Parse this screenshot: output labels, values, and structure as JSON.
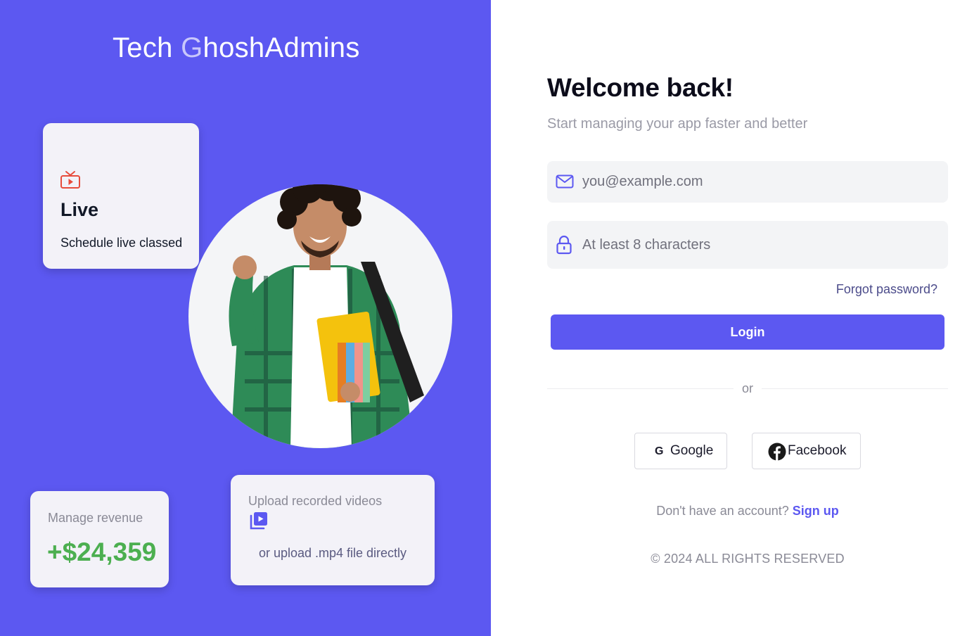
{
  "brand": {
    "part1": "Tech ",
    "part2": "G",
    "part3": "hoshAdmins"
  },
  "cards": {
    "live": {
      "icon": "live-tv-icon",
      "title": "Live",
      "subtitle": "Schedule live classed"
    },
    "revenue": {
      "label": "Manage revenue",
      "value": "+$24,359"
    },
    "upload": {
      "label": "Upload recorded videos",
      "icon": "video-library-icon",
      "subtitle": "or upload .mp4 file directly"
    }
  },
  "login": {
    "heading": "Welcome back!",
    "subheading": "Start managing your app faster and better",
    "email": {
      "icon": "mail-icon",
      "value": "",
      "placeholder": "you@example.com"
    },
    "password": {
      "icon": "lock-icon",
      "value": "",
      "placeholder": "At least 8 characters"
    },
    "forgot_label": "Forgot password?",
    "submit_label": "Login",
    "divider_label": "or",
    "social": [
      {
        "icon": "google-icon",
        "label": "Google"
      },
      {
        "icon": "facebook-icon",
        "label": "Facebook"
      }
    ],
    "signup_prompt": "Don't have an account?",
    "signup_label": "Sign up",
    "copyright": "© 2024 ALL RIGHTS RESERVED"
  },
  "colors": {
    "accent": "#5c58f1",
    "revenue": "#4caf50",
    "live_icon": "#e74c3c"
  }
}
